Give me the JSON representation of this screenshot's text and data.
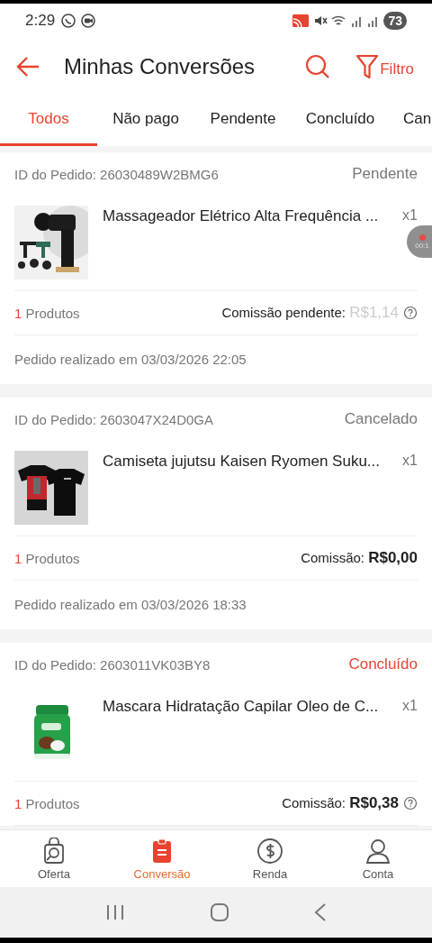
{
  "status_bar": {
    "time": "2:29",
    "battery": "73"
  },
  "header": {
    "title": "Minhas Conversões",
    "filter_label": "Filtro"
  },
  "tabs": [
    {
      "label": "Todos",
      "selected": true
    },
    {
      "label": "Não pago",
      "selected": false
    },
    {
      "label": "Pendente",
      "selected": false
    },
    {
      "label": "Concluído",
      "selected": false
    },
    {
      "label": "Can",
      "selected": false
    }
  ],
  "orders": [
    {
      "order_id": "ID do Pedido: 26030489W2BMG6",
      "status": "Pendente",
      "status_highlighted": false,
      "product": {
        "name": "Massageador Elétrico Alta Frequência ...",
        "quantity": "x1"
      },
      "product_count": "1",
      "products_label": "Produtos",
      "commission_label": "Comissão pendente:",
      "commission_value": "R$1,14",
      "commission_pending": true,
      "help_icon": true,
      "date": "Pedido realizado em 03/03/2026 22:05"
    },
    {
      "order_id": "ID do Pedido: 2603047X24D0GA",
      "status": "Cancelado",
      "status_highlighted": false,
      "product": {
        "name": "Camiseta jujutsu Kaisen Ryomen Suku...",
        "quantity": "x1"
      },
      "product_count": "1",
      "products_label": "Produtos",
      "commission_label": "Comissão:",
      "commission_value": "R$0,00",
      "commission_pending": false,
      "help_icon": false,
      "date": "Pedido realizado em 03/03/2026 18:33"
    },
    {
      "order_id": "ID do Pedido: 2603011VK03BY8",
      "status": "Concluído",
      "status_highlighted": true,
      "product": {
        "name": "Mascara Hidratação Capilar Oleo de C...",
        "quantity": "x1"
      },
      "product_count": "1",
      "products_label": "Produtos",
      "commission_label": "Comissão:",
      "commission_value": "R$0,38",
      "commission_pending": false,
      "help_icon": true
    }
  ],
  "recorder": {
    "time": "00:1"
  },
  "bottom_nav": [
    {
      "label": "Oferta",
      "selected": false
    },
    {
      "label": "Conversão",
      "selected": true
    },
    {
      "label": "Renda",
      "selected": false
    },
    {
      "label": "Conta",
      "selected": false
    }
  ]
}
